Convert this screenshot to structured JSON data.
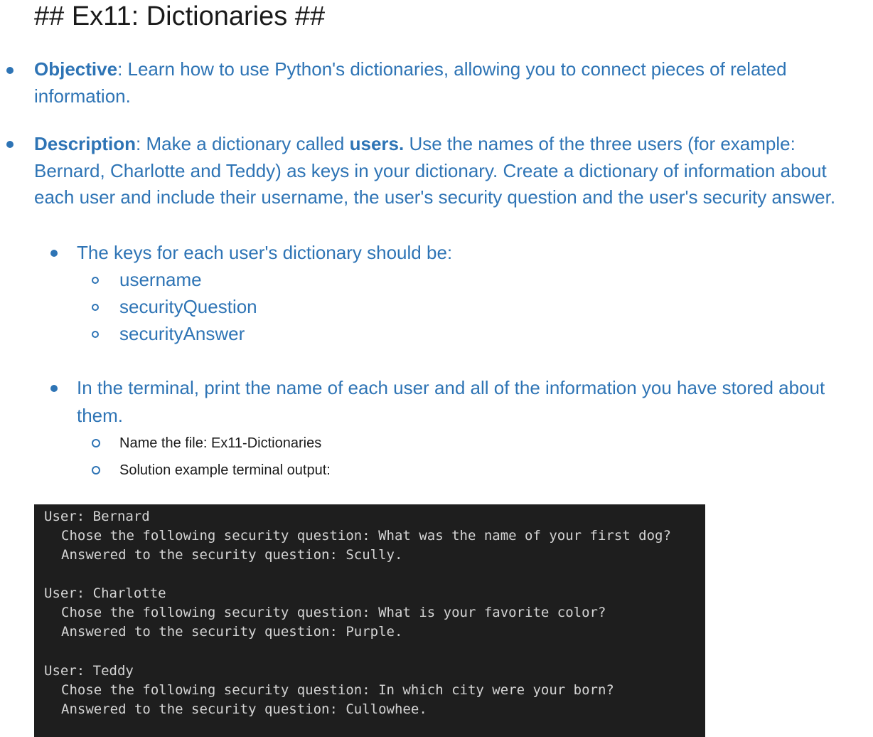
{
  "title": "## Ex11: Dictionaries ##",
  "objective": {
    "label": "Objective",
    "text": ": Learn how to use Python's dictionaries, allowing you to connect pieces of related information."
  },
  "description": {
    "label": "Description",
    "text1": ": Make a dictionary called ",
    "bold_word": "users.",
    "text2": " Use the names of the three users (for example: Bernard, Charlotte and Teddy) as keys in your dictionary. Create a dictionary of information about each user and include their username, the user's security question and the user's security answer."
  },
  "keys_heading": "The keys for each user's dictionary should be:",
  "keys": [
    "username",
    "securityQuestion",
    "securityAnswer"
  ],
  "terminal_instruction": "In the terminal, print the name of each user and all of the information you have stored about them.",
  "file_name": "Name the file: Ex11-Dictionaries",
  "solution_label": "Solution example terminal output:",
  "terminal": {
    "lines": [
      "User: Bernard",
      "Chose the following security question: What was the name of your first dog?",
      "Answered to the security question: Scully.",
      "User: Charlotte",
      "Chose the following security question: What is your favorite color?",
      "Answered to the security question: Purple.",
      "User: Teddy",
      "Chose the following security question: In which city were your born?",
      "Answered to the security question: Cullowhee."
    ]
  },
  "colors": {
    "accent": "#2e74b5",
    "terminal_bg": "#1e1e1e",
    "terminal_text": "#d4d4d4"
  }
}
